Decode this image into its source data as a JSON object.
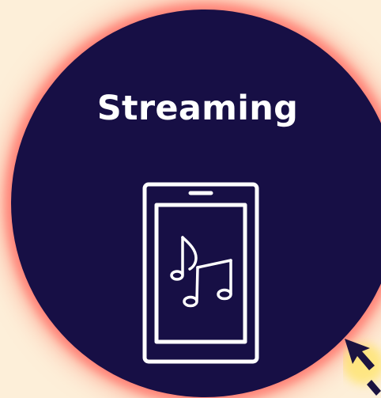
{
  "card": {
    "title": "Streaming",
    "icon": "phone-music-icon",
    "colors": {
      "background": "#fdefd9",
      "circle": "#170f45",
      "glow": "#ff7a6e",
      "foreground": "#ffffff",
      "cursor": "#1b1340",
      "cursor_glow": "#ffe03d"
    }
  },
  "decor": {
    "cursor_icon": "cursor-arrow-icon"
  }
}
